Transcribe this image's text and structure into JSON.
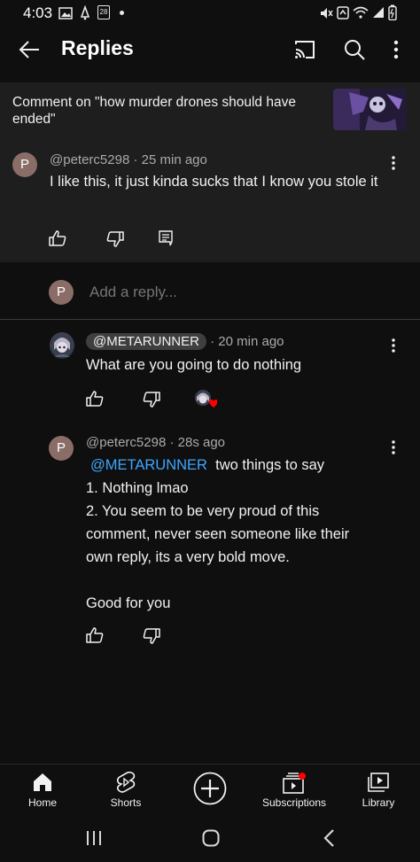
{
  "status_bar": {
    "time": "4:03",
    "calendar_day": "28"
  },
  "app_bar": {
    "title": "Replies"
  },
  "context": {
    "text": "Comment on \"how murder drones should have ended\""
  },
  "parent_comment": {
    "avatar_letter": "P",
    "author": "@peterc5298",
    "time": "25 min ago",
    "text": "I like this, it just kinda sucks that I know you stole it"
  },
  "add_reply": {
    "avatar_letter": "P",
    "placeholder": "Add a reply..."
  },
  "replies": [
    {
      "author": "@METARUNNER",
      "time": "20 min ago",
      "text": "What are you going to do nothing"
    },
    {
      "avatar_letter": "P",
      "author": "@peterc5298",
      "time": "28s ago",
      "mention": "@METARUNNER",
      "line1": "two things to say",
      "line2": "1. Nothing lmao",
      "line3": "2. You seem to be very proud of this",
      "line4": "comment, never seen someone like their",
      "line5": "own reply, its a very bold move.",
      "line6": "Good for you"
    }
  ],
  "bottom_nav": {
    "home": "Home",
    "shorts": "Shorts",
    "subscriptions": "Subscriptions",
    "library": "Library"
  },
  "colors": {
    "accent_link": "#3ea6ff",
    "notification_dot": "#ff0000",
    "heart": "#ff0000"
  }
}
